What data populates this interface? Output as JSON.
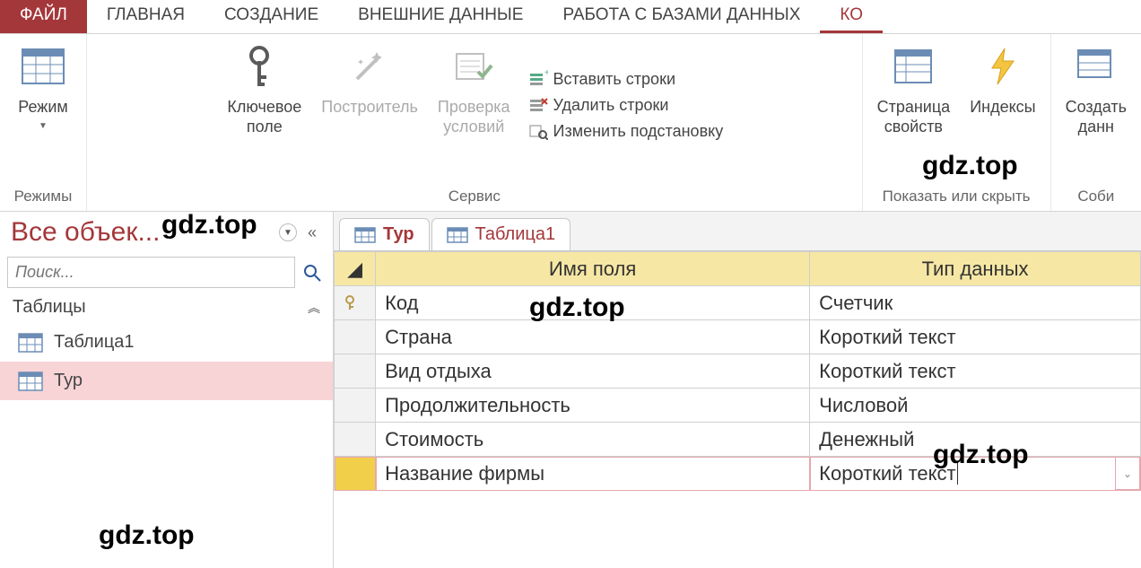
{
  "ribbon_tabs": {
    "file": "ФАЙЛ",
    "home": "ГЛАВНАЯ",
    "create": "СОЗДАНИЕ",
    "external": "ВНЕШНИЕ ДАННЫЕ",
    "dbtools": "РАБОТА С БАЗАМИ ДАННЫХ",
    "design_partial": "КО"
  },
  "ribbon": {
    "group_modes": {
      "view": "Режим",
      "label": "Режимы"
    },
    "group_service": {
      "primary_key": "Ключевое\nполе",
      "builder": "Построитель",
      "validation": "Проверка\nусловий",
      "insert_rows": "Вставить строки",
      "delete_rows": "Удалить строки",
      "modify_lookup": "Изменить подстановку",
      "label": "Сервис"
    },
    "group_show": {
      "property_sheet": "Страница\nсвойств",
      "indexes": "Индексы",
      "label": "Показать или скрыть"
    },
    "group_events": {
      "create_macro": "Создать\nданн",
      "label": "Соби"
    }
  },
  "nav": {
    "title": "Все объек...",
    "search_placeholder": "Поиск...",
    "section_tables": "Таблицы",
    "items": [
      {
        "label": "Таблица1",
        "selected": false
      },
      {
        "label": "Тур",
        "selected": true
      }
    ]
  },
  "doc_tabs": [
    {
      "label": "Тур",
      "active": true
    },
    {
      "label": "Таблица1",
      "active": false
    }
  ],
  "grid": {
    "header_name": "Имя поля",
    "header_type": "Тип данных",
    "rows": [
      {
        "key": true,
        "name": "Код",
        "type": "Счетчик",
        "current": false
      },
      {
        "key": false,
        "name": "Страна",
        "type": "Короткий текст",
        "current": false
      },
      {
        "key": false,
        "name": "Вид отдыха",
        "type": "Короткий текст",
        "current": false
      },
      {
        "key": false,
        "name": "Продолжительность",
        "type": "Числовой",
        "current": false
      },
      {
        "key": false,
        "name": "Стоимость",
        "type": "Денежный",
        "current": false
      },
      {
        "key": false,
        "name": "Название фирмы",
        "type": "Короткий текст",
        "current": true
      }
    ]
  },
  "watermarks": [
    "gdz.top",
    "gdz.top",
    "gdz.top",
    "gdz.top",
    "gdz.top"
  ]
}
